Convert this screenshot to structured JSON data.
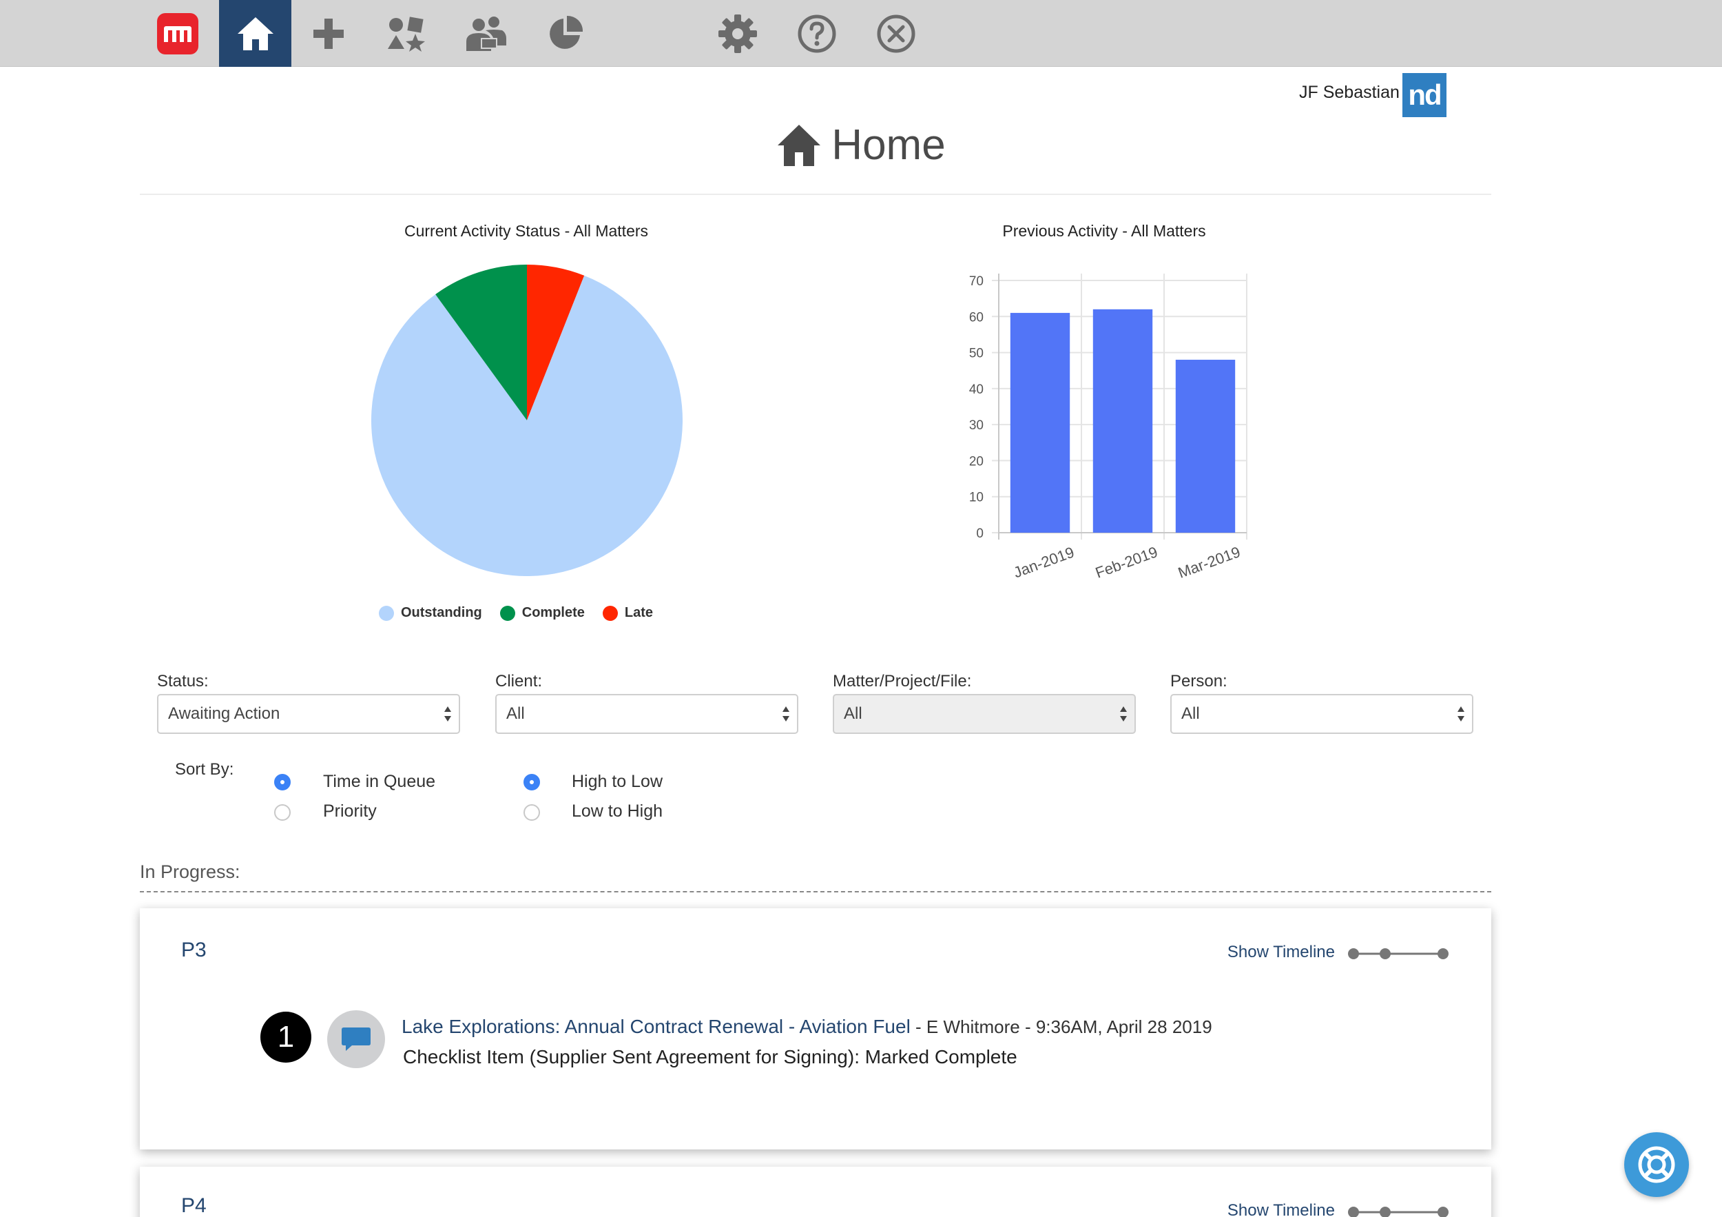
{
  "nav": {
    "items": [
      {
        "name": "app-logo",
        "icon": "app-logo-icon"
      },
      {
        "name": "home",
        "icon": "home-icon",
        "active": true
      },
      {
        "name": "add",
        "icon": "plus-icon"
      },
      {
        "name": "templates",
        "icon": "shapes-icon"
      },
      {
        "name": "people",
        "icon": "users-icon"
      },
      {
        "name": "reports",
        "icon": "pie-chart-icon"
      },
      {
        "name": "settings",
        "icon": "gear-icon"
      },
      {
        "name": "help",
        "icon": "help-circle-icon"
      },
      {
        "name": "close",
        "icon": "close-circle-icon"
      }
    ]
  },
  "user": {
    "name": "JF Sebastian",
    "logo_text": "nd"
  },
  "page": {
    "title": "Home"
  },
  "chart_data": [
    {
      "type": "pie",
      "title": "Current Activity Status - All Matters",
      "slices": [
        {
          "label": "Outstanding",
          "value": 84,
          "color": "#b3d4fc"
        },
        {
          "label": "Complete",
          "value": 10,
          "color": "#00914c"
        },
        {
          "label": "Late",
          "value": 6,
          "color": "#ff2600"
        }
      ],
      "legend_position": "bottom"
    },
    {
      "type": "bar",
      "title": "Previous Activity - All Matters",
      "categories": [
        "Jan-2019",
        "Feb-2019",
        "Mar-2019"
      ],
      "values": [
        61,
        62,
        48
      ],
      "color": "#5275f7",
      "ylim": [
        0,
        70
      ],
      "yticks": [
        0,
        10,
        20,
        30,
        40,
        50,
        60,
        70
      ],
      "grid": true
    }
  ],
  "filters": [
    {
      "label": "Status:",
      "value": "Awaiting Action",
      "disabled": false
    },
    {
      "label": "Client:",
      "value": "All",
      "disabled": false
    },
    {
      "label": "Matter/Project/File:",
      "value": "All",
      "disabled": true
    },
    {
      "label": "Person:",
      "value": "All",
      "disabled": false
    }
  ],
  "sort": {
    "label": "Sort By:",
    "field_options": [
      {
        "label": "Time in Queue",
        "checked": true
      },
      {
        "label": "Priority",
        "checked": false
      }
    ],
    "order_options": [
      {
        "label": "High to Low",
        "checked": true
      },
      {
        "label": "Low to High",
        "checked": false
      }
    ]
  },
  "in_progress": {
    "label": "In Progress:",
    "cards": [
      {
        "title": "P3",
        "timeline_label": "Show Timeline",
        "item": {
          "number": "1",
          "link": "Lake Explorations: Annual Contract Renewal - Aviation Fuel",
          "meta": " - E Whitmore - 9:36AM, April 28 2019",
          "detail": "Checklist Item (Supplier Sent Agreement for Signing): Marked Complete"
        }
      },
      {
        "title": "P4",
        "timeline_label": "Show Timeline"
      }
    ]
  },
  "help_fab": {
    "icon": "lifebuoy-icon"
  }
}
